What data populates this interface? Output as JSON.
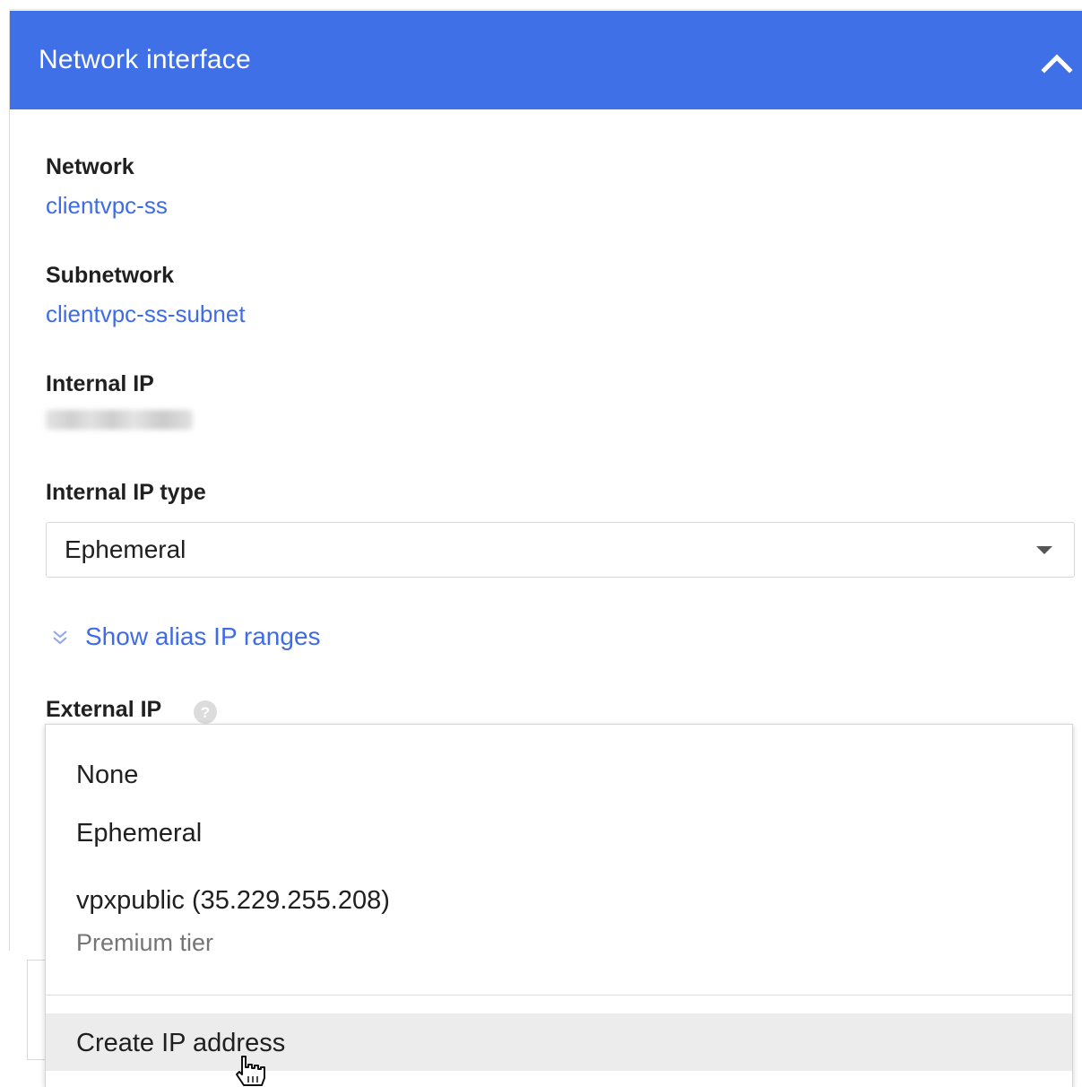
{
  "panel": {
    "title": "Network interface",
    "header_color": "#4070e8",
    "collapse_icon": "chevron-up-icon"
  },
  "fields": {
    "network": {
      "label": "Network",
      "value": "clientvpc-ss"
    },
    "subnetwork": {
      "label": "Subnetwork",
      "value": "clientvpc-ss-subnet"
    },
    "internal_ip": {
      "label": "Internal IP"
    },
    "internal_ip_type": {
      "label": "Internal IP type",
      "selected": "Ephemeral"
    },
    "alias_toggle": {
      "label": "Show alias IP ranges",
      "icon": "double-chevron-down-icon"
    },
    "external_ip": {
      "label": "External IP",
      "help_icon": "help-icon"
    }
  },
  "external_ip_menu": {
    "options": [
      {
        "label": "None"
      },
      {
        "label": "Ephemeral"
      },
      {
        "label": "vpxpublic (35.229.255.208)",
        "sublabel": "Premium tier"
      }
    ],
    "action": {
      "label": "Create IP address",
      "hovered": true
    }
  },
  "colors": {
    "link": "#3f6ce6",
    "hover": "#ececec"
  }
}
